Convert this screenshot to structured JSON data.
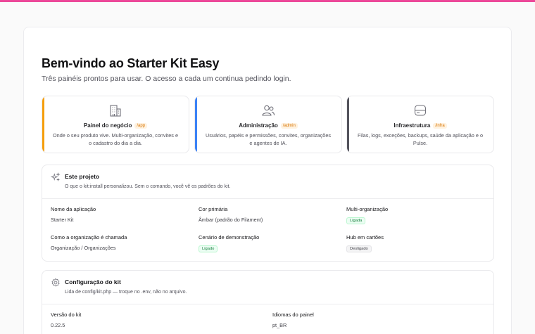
{
  "brand": {
    "accent_color": "#ec4899"
  },
  "page": {
    "title": "Bem-vindo ao Starter Kit Easy",
    "subtitle": "Três painéis prontos para usar. O acesso a cada um continua pedindo login."
  },
  "panels": [
    {
      "icon": "building-icon",
      "title": "Painel do negócio",
      "path": "/app",
      "description": "Onde o seu produto vive. Multi-organização, convites e o cadastro do dia a dia.",
      "accent": "#f59e0b"
    },
    {
      "icon": "users-icon",
      "title": "Administração",
      "path": "/admin",
      "description": "Usuários, papéis e permissões, convites, organizações e agentes de IA.",
      "accent": "#3b82f6"
    },
    {
      "icon": "server-icon",
      "title": "Infraestrutura",
      "path": "/infra",
      "description": "Filas, logs, exceções, backups, saúde da aplicação e o Pulse.",
      "accent": "#52525b"
    }
  ],
  "project": {
    "icon": "sparkles-icon",
    "title": "Este projeto",
    "description": "O que o kit:install personalizou. Sem o comando, você vê os padrões do kit.",
    "fields": {
      "app_name": {
        "label": "Nome da aplicação",
        "value": "Starter Kit"
      },
      "primary_color": {
        "label": "Cor primária",
        "value": "Âmbar (padrão do Filament)"
      },
      "multi_org": {
        "label": "Multi-organização",
        "value": "Ligada",
        "state": "on"
      },
      "org_naming": {
        "label": "Como a organização é chamada",
        "value": "Organização / Organizações"
      },
      "demo_scenario": {
        "label": "Cenário de demonstração",
        "value": "Ligado",
        "state": "on"
      },
      "hub_cards": {
        "label": "Hub em cartões",
        "value": "Desligado",
        "state": "off"
      }
    }
  },
  "config": {
    "icon": "gear-icon",
    "title": "Configuração do kit",
    "description": "Lida de config/kit.php — troque no .env, não no arquivo.",
    "fields": {
      "version": {
        "label": "Versão do kit",
        "value": "0.22.5"
      },
      "languages": {
        "label": "Idiomas do painel",
        "value": "pt_BR"
      }
    }
  }
}
